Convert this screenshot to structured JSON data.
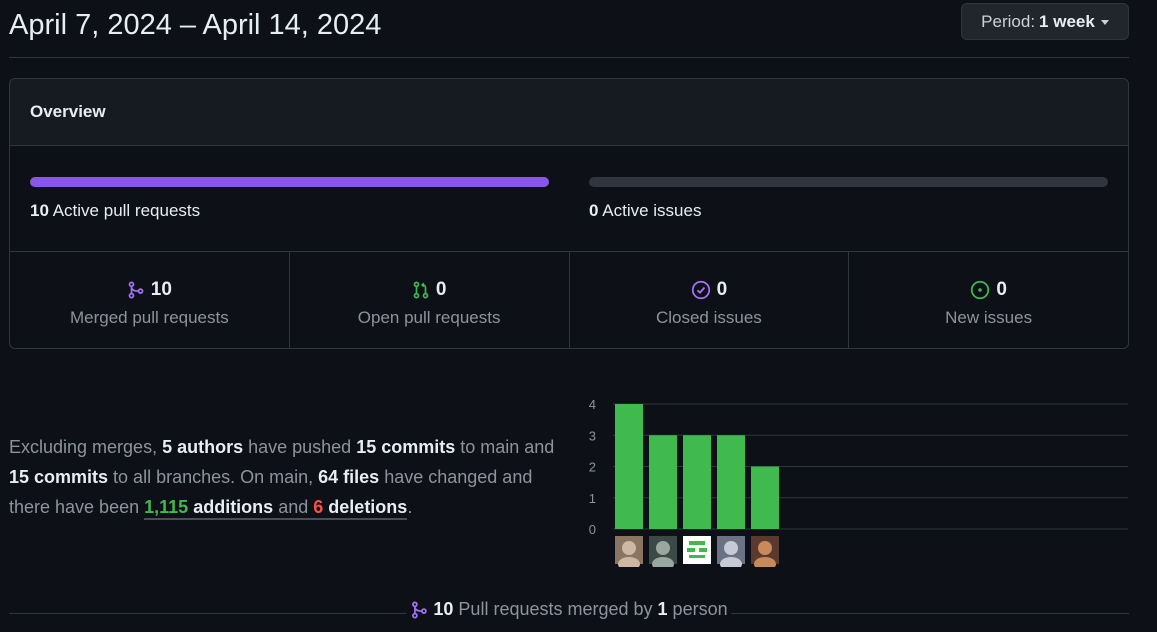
{
  "header": {
    "title": "April 7, 2024 – April 14, 2024",
    "period_label": "Period:",
    "period_value": "1 week"
  },
  "overview": {
    "title": "Overview",
    "pull_requests": {
      "count": "10",
      "label": "Active pull requests",
      "fill_fraction": 1.0,
      "color": "#8957e5"
    },
    "issues": {
      "count": "0",
      "label": "Active issues",
      "fill_fraction": 0.0,
      "color": "#30363d"
    },
    "stats": [
      {
        "icon": "merge-icon",
        "count": "10",
        "label": "Merged pull requests",
        "color": "#a371f7"
      },
      {
        "icon": "pull-request-icon",
        "count": "0",
        "label": "Open pull requests",
        "color": "#3fb950"
      },
      {
        "icon": "issue-closed-icon",
        "count": "0",
        "label": "Closed issues",
        "color": "#a371f7"
      },
      {
        "icon": "issue-opened-icon",
        "count": "0",
        "label": "New issues",
        "color": "#3fb950"
      }
    ]
  },
  "summary": {
    "t1": "Excluding merges, ",
    "authors": "5 authors",
    "t2": " have pushed ",
    "commits_main": "15 commits",
    "t3": " to main and ",
    "commits_all": "15 commits",
    "t4": " to all branches. On main, ",
    "files": "64 files",
    "t5": " have changed and there have been ",
    "additions_num": "1,115",
    "additions_word": "additions",
    "t6": "and",
    "deletions_num": "6",
    "deletions_word": "deletions",
    "t7": "."
  },
  "chart_data": {
    "type": "bar",
    "categories": [
      "author-1",
      "author-2",
      "author-3",
      "author-4",
      "author-5"
    ],
    "values": [
      4,
      3,
      3,
      3,
      2
    ],
    "ylim": [
      0,
      4
    ],
    "yticks": [
      "0",
      "1",
      "2",
      "3",
      "4"
    ],
    "bar_color": "#40ba4f",
    "grid": true
  },
  "footer": {
    "count": "10",
    "text1": "Pull requests merged by",
    "persons": "1",
    "text2": "person"
  }
}
